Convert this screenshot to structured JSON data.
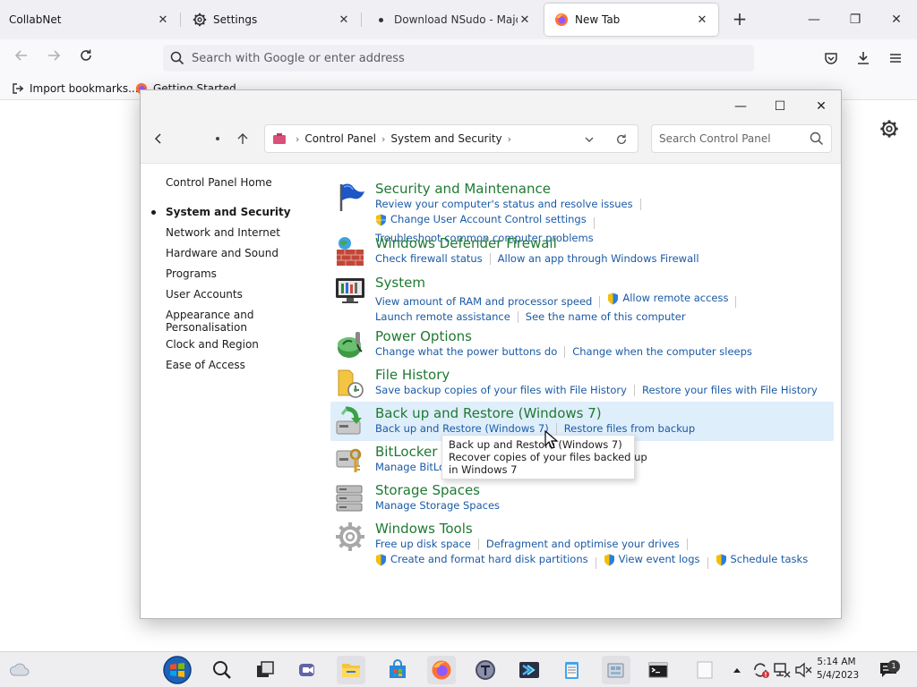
{
  "browser": {
    "tabs": [
      {
        "title": "CollabNet"
      },
      {
        "title": "Settings"
      },
      {
        "title": "Download NSudo - MajorGeeks"
      },
      {
        "title": "New Tab"
      }
    ],
    "url_placeholder": "Search with Google or enter address",
    "bookmarks": [
      {
        "label": "Import bookmarks..."
      },
      {
        "label": "Getting Started"
      }
    ]
  },
  "control_panel": {
    "breadcrumb": [
      "Control Panel",
      "System and Security"
    ],
    "search_placeholder": "Search Control Panel",
    "sidebar": {
      "home": "Control Panel Home",
      "items": [
        {
          "label": "System and Security",
          "current": true
        },
        {
          "label": "Network and Internet"
        },
        {
          "label": "Hardware and Sound"
        },
        {
          "label": "Programs"
        },
        {
          "label": "User Accounts"
        },
        {
          "label": "Appearance and\nPersonalisation"
        },
        {
          "label": "Clock and Region"
        },
        {
          "label": "Ease of Access"
        }
      ]
    },
    "categories": [
      {
        "title": "Security and Maintenance",
        "icon": "flag-icon",
        "links": [
          "Review your computer's status and resolve issues",
          "Change User Account Control settings",
          "Troubleshoot common computer problems"
        ]
      },
      {
        "title": "Windows Defender Firewall",
        "icon": "firewall-icon",
        "links": [
          "Check firewall status",
          "Allow an app through Windows Firewall"
        ]
      },
      {
        "title": "System",
        "icon": "system-icon",
        "links": [
          "View amount of RAM and processor speed",
          "Allow remote access",
          "Launch remote assistance",
          "See the name of this computer"
        ]
      },
      {
        "title": "Power Options",
        "icon": "power-options-icon",
        "links": [
          "Change what the power buttons do",
          "Change when the computer sleeps"
        ]
      },
      {
        "title": "File History",
        "icon": "file-history-icon",
        "links": [
          "Save backup copies of your files with File History",
          "Restore your files with File History"
        ]
      },
      {
        "title": "Back up and Restore (Windows 7)",
        "icon": "backup-icon",
        "links": [
          "Back up and Restore (Windows 7)",
          "Restore files from backup"
        ]
      },
      {
        "title": "BitLocker Drive Encryption",
        "icon": "bitlocker-icon",
        "links": [
          "Manage BitLocker"
        ]
      },
      {
        "title": "Storage Spaces",
        "icon": "storage-spaces-icon",
        "links": [
          "Manage Storage Spaces"
        ]
      },
      {
        "title": "Windows Tools",
        "icon": "windows-tools-icon",
        "links": [
          "Free up disk space",
          "Defragment and optimise your drives",
          "Create and format hard disk partitions",
          "View event logs",
          "Schedule tasks"
        ]
      }
    ],
    "tooltip": {
      "title": "Back up and Restore (Windows 7)",
      "line1": "Recover copies of your files backed up",
      "line2": "in Windows 7"
    }
  },
  "taskbar": {
    "time": "5:14 AM",
    "date": "5/4/2023",
    "notifications": "1"
  },
  "colors": {
    "category_title": "#1e7a33",
    "link": "#1a5aa5",
    "hover_highlight": "#dfeefb",
    "tab_strip": "#f0f0f4"
  }
}
